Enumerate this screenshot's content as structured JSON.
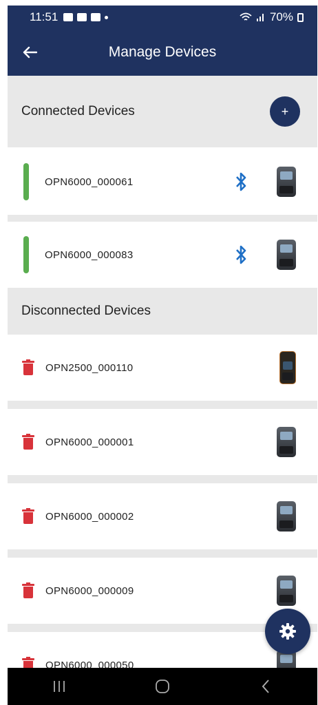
{
  "status_bar": {
    "time": "11:51",
    "battery": "70%"
  },
  "app_bar": {
    "title": "Manage Devices"
  },
  "connected": {
    "title": "Connected Devices",
    "add_label": "+",
    "devices": [
      {
        "name": "OPN6000_000061"
      },
      {
        "name": "OPN6000_000083"
      }
    ]
  },
  "disconnected": {
    "title": "Disconnected Devices",
    "devices": [
      {
        "name": "OPN2500_000110"
      },
      {
        "name": "OPN6000_000001"
      },
      {
        "name": "OPN6000_000002"
      },
      {
        "name": "OPN6000_000009"
      },
      {
        "name": "OPN6000_000050"
      }
    ]
  },
  "colors": {
    "primary": "#1f3260",
    "connected": "#5aad4f",
    "delete": "#d8333a",
    "bluetooth": "#1e6fc6",
    "section_bg": "#e8e8e8"
  },
  "icons": {
    "back": "arrow-left-icon",
    "bluetooth": "bluetooth-icon",
    "trash": "trash-icon",
    "settings": "gear-icon"
  }
}
